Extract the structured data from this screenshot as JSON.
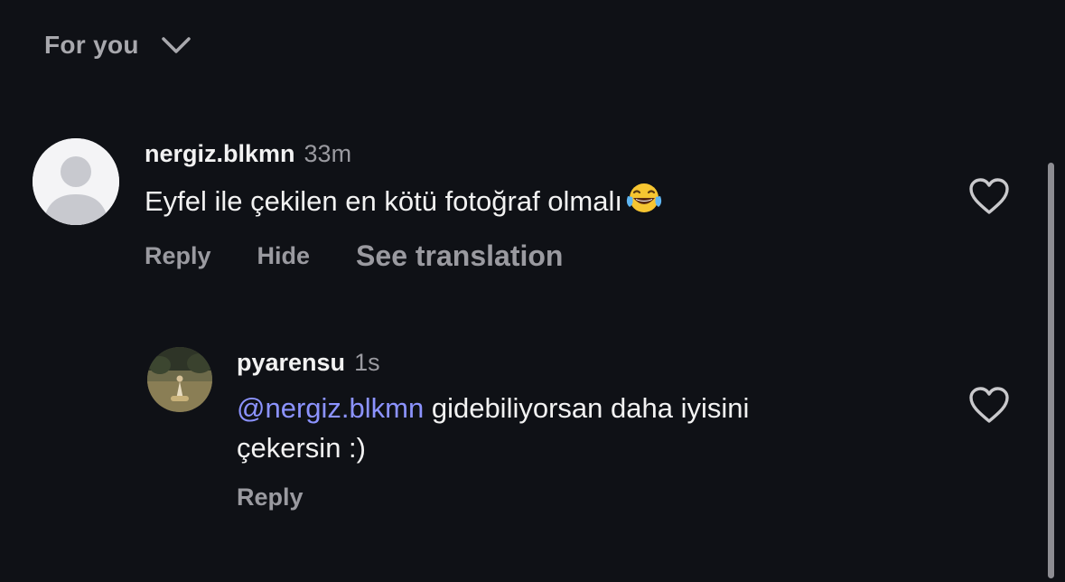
{
  "header": {
    "title": "For you",
    "chevron_icon": "chevron-down-icon"
  },
  "comments": [
    {
      "username": "nergiz.blkmn",
      "time": "33m",
      "text": "Eyfel ile çekilen en kötü fotoğraf olmalı",
      "emoji": "😂",
      "actions": {
        "reply": "Reply",
        "hide": "Hide",
        "translate": "See translation"
      },
      "avatar_icon": "default-avatar-icon",
      "like_icon": "heart-icon"
    }
  ],
  "replies": [
    {
      "username": "pyarensu",
      "time": "1s",
      "mention": "@nergiz.blkmn",
      "text_line1": " gidebiliyorsan daha iyisini",
      "text_line2": "çekersin :)",
      "actions": {
        "reply": "Reply"
      },
      "avatar_icon": "user-photo-avatar",
      "like_icon": "heart-icon"
    }
  ],
  "colors": {
    "background": "#0f1116",
    "text_primary": "#f2f2f2",
    "text_secondary": "#9a9aa0",
    "mention": "#8c93ff",
    "scrollbar": "#8d8d92"
  }
}
